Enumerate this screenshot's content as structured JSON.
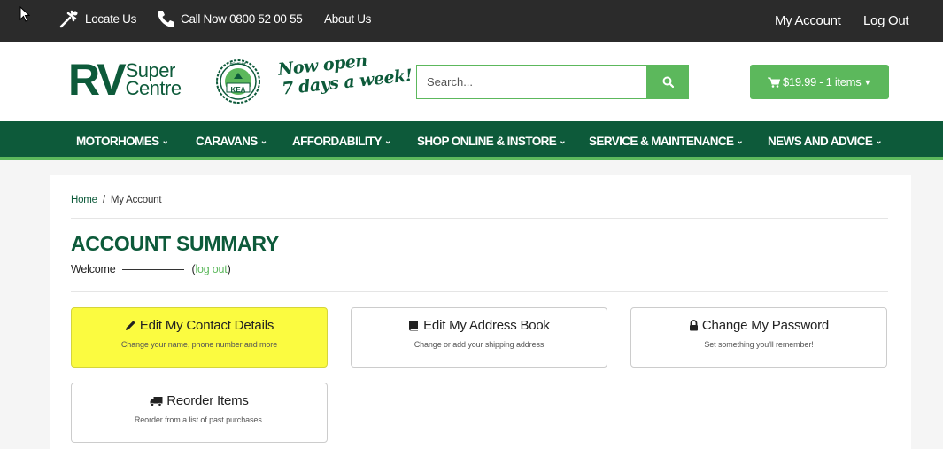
{
  "topbar": {
    "locate": "Locate Us",
    "call": "Call Now 0800 52 00 55",
    "about": "About Us",
    "my_account": "My Account",
    "logout": "Log Out"
  },
  "header": {
    "logo_rv": "RV",
    "logo_super": "Super",
    "logo_centre": "Centre",
    "seal_top": "HOME OF",
    "seal_text": "KEA",
    "tagline_1": "Now open",
    "tagline_2": "7 days a week!",
    "search_placeholder": "Search...",
    "cart_label": "$19.99 - 1 items"
  },
  "nav": {
    "items": [
      {
        "label": "MOTORHOMES"
      },
      {
        "label": "CARAVANS"
      },
      {
        "label": "AFFORDABILITY"
      },
      {
        "label": "SHOP ONLINE & INSTORE"
      },
      {
        "label": "SERVICE & MAINTENANCE"
      },
      {
        "label": "NEWS AND ADVICE"
      }
    ]
  },
  "breadcrumb": {
    "home": "Home",
    "sep": "/",
    "current": "My Account"
  },
  "page": {
    "title": "ACCOUNT SUMMARY",
    "welcome": "Welcome",
    "logout_link": "log out"
  },
  "cards": [
    {
      "title": "Edit My Contact Details",
      "sub": "Change your name, phone number and more",
      "icon": "pencil-icon"
    },
    {
      "title": "Edit My Address Book",
      "sub": "Change or add your shipping address",
      "icon": "book-icon"
    },
    {
      "title": "Change My Password",
      "sub": "Set something you'll remember!",
      "icon": "lock-icon"
    },
    {
      "title": "Reorder Items",
      "sub": "Reorder from a list of past purchases.",
      "icon": "truck-icon"
    }
  ],
  "colors": {
    "dark_green": "#0d5a3a",
    "light_green": "#5cb85c",
    "highlight": "#fbfb40",
    "topbar": "#2b2b2b"
  }
}
